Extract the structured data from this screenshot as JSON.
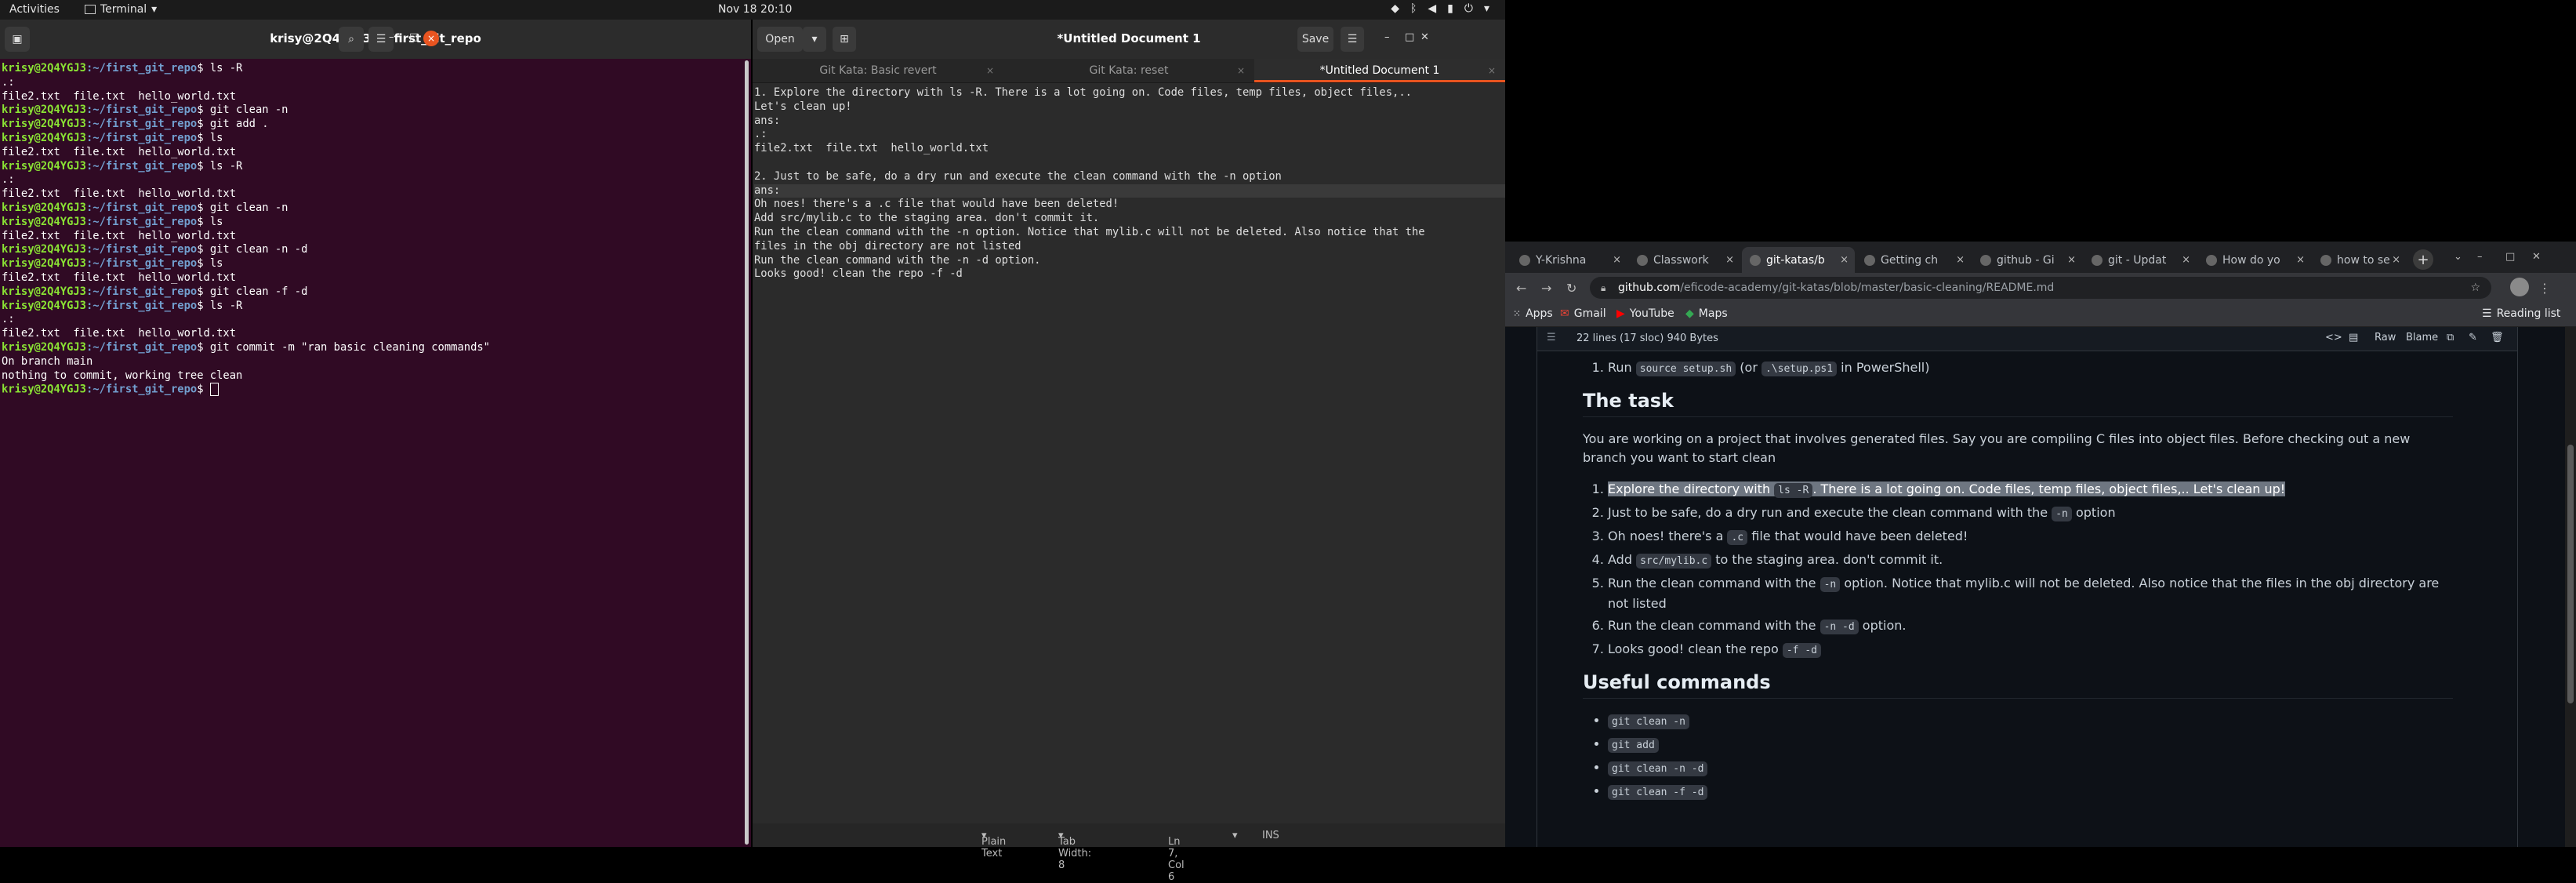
{
  "topbar": {
    "activities": "Activities",
    "app_name": "Terminal",
    "clock": "Nov 18  20:10"
  },
  "terminal": {
    "title": "krisy@2Q4YGJ3: ~/first_git_repo",
    "lines": [
      {
        "kind": "cmd",
        "user": "krisy@2Q4YGJ3",
        "path": ":~/first_git_repo",
        "cmd": "$ ls -R"
      },
      {
        "kind": "out",
        "text": ".:"
      },
      {
        "kind": "out",
        "text": "file2.txt  file.txt  hello_world.txt"
      },
      {
        "kind": "cmd",
        "user": "krisy@2Q4YGJ3",
        "path": ":~/first_git_repo",
        "cmd": "$ git clean -n"
      },
      {
        "kind": "cmd",
        "user": "krisy@2Q4YGJ3",
        "path": ":~/first_git_repo",
        "cmd": "$ git add ."
      },
      {
        "kind": "cmd",
        "user": "krisy@2Q4YGJ3",
        "path": ":~/first_git_repo",
        "cmd": "$ ls"
      },
      {
        "kind": "out",
        "text": "file2.txt  file.txt  hello_world.txt"
      },
      {
        "kind": "cmd",
        "user": "krisy@2Q4YGJ3",
        "path": ":~/first_git_repo",
        "cmd": "$ ls -R"
      },
      {
        "kind": "out",
        "text": ".:"
      },
      {
        "kind": "out",
        "text": "file2.txt  file.txt  hello_world.txt"
      },
      {
        "kind": "cmd",
        "user": "krisy@2Q4YGJ3",
        "path": ":~/first_git_repo",
        "cmd": "$ git clean -n"
      },
      {
        "kind": "cmd",
        "user": "krisy@2Q4YGJ3",
        "path": ":~/first_git_repo",
        "cmd": "$ ls"
      },
      {
        "kind": "out",
        "text": "file2.txt  file.txt  hello_world.txt"
      },
      {
        "kind": "cmd",
        "user": "krisy@2Q4YGJ3",
        "path": ":~/first_git_repo",
        "cmd": "$ git clean -n -d"
      },
      {
        "kind": "cmd",
        "user": "krisy@2Q4YGJ3",
        "path": ":~/first_git_repo",
        "cmd": "$ ls"
      },
      {
        "kind": "out",
        "text": "file2.txt  file.txt  hello_world.txt"
      },
      {
        "kind": "cmd",
        "user": "krisy@2Q4YGJ3",
        "path": ":~/first_git_repo",
        "cmd": "$ git clean -f -d"
      },
      {
        "kind": "cmd",
        "user": "krisy@2Q4YGJ3",
        "path": ":~/first_git_repo",
        "cmd": "$ ls -R"
      },
      {
        "kind": "out",
        "text": ".:"
      },
      {
        "kind": "out",
        "text": "file2.txt  file.txt  hello_world.txt"
      },
      {
        "kind": "cmd",
        "user": "krisy@2Q4YGJ3",
        "path": ":~/first_git_repo",
        "cmd": "$ git commit -m \"ran basic cleaning commands\""
      },
      {
        "kind": "out",
        "text": "On branch main"
      },
      {
        "kind": "out",
        "text": "nothing to commit, working tree clean"
      },
      {
        "kind": "prompt",
        "user": "krisy@2Q4YGJ3",
        "path": ":~/first_git_repo",
        "cmd": "$ "
      }
    ]
  },
  "gedit": {
    "title": "*Untitled Document 1",
    "open_label": "Open",
    "save_label": "Save",
    "tabs": [
      "Git Kata: Basic revert",
      "Git Kata: reset",
      "*Untitled Document 1"
    ],
    "lines": [
      "1. Explore the directory with ls -R. There is a lot going on. Code files, temp files, object files,..",
      "Let's clean up!",
      "ans:",
      ".:",
      "file2.txt  file.txt  hello_world.txt",
      "",
      "2. Just to be safe, do a dry run and execute the clean command with the -n option",
      "ans:",
      "Oh noes! there's a .c file that would have been deleted!",
      "Add src/mylib.c to the staging area. don't commit it.",
      "Run the clean command with the -n option. Notice that mylib.c will not be deleted. Also notice that the",
      "files in the obj directory are not listed",
      "Run the clean command with the -n -d option.",
      "Looks good! clean the repo -f -d"
    ],
    "status": {
      "language": "Plain Text",
      "tab_width": "Tab Width: 8",
      "position": "Ln 7, Col 6",
      "mode": "INS"
    }
  },
  "browser": {
    "tabs": [
      {
        "label": "Y-Krishna"
      },
      {
        "label": "Classwork"
      },
      {
        "label": "git-katas/b"
      },
      {
        "label": "Getting ch"
      },
      {
        "label": "github - Gi"
      },
      {
        "label": "git - Updat"
      },
      {
        "label": "How do yo"
      },
      {
        "label": "how to se"
      }
    ],
    "url_host": "github.com",
    "url_path": "/eficode-academy/git-katas/blob/master/basic-cleaning/README.md",
    "bookmarks": [
      "Apps",
      "Gmail",
      "YouTube",
      "Maps"
    ],
    "reading_list": "Reading list",
    "file_meta": "22 lines (17 sloc)    940 Bytes",
    "raw_label": "Raw",
    "blame_label": "Blame",
    "readme": {
      "setup_prefix": "Run",
      "setup_code1": "source setup.sh",
      "setup_mid": "(or",
      "setup_code2": ".\\setup.ps1",
      "setup_suffix": "in PowerShell)",
      "task_heading": "The task",
      "task_intro": "You are working on a project that involves generated files. Say you are compiling C files into object files. Before checking out a new branch you want to start clean",
      "step1_a": "Explore the directory with",
      "step1_code": "ls -R",
      "step1_b": ". There is a lot going on. Code files, temp files, object files,.. Let's clean up!",
      "step2_a": "Just to be safe, do a dry run and execute the clean command with the",
      "step2_code": "-n",
      "step2_b": "option",
      "step3_a": "Oh noes! there's a",
      "step3_code": ".c",
      "step3_b": "file that would have been deleted!",
      "step4_a": "Add",
      "step4_code": "src/mylib.c",
      "step4_b": "to the staging area. don't commit it.",
      "step5_a": "Run the clean command with the",
      "step5_code": "-n",
      "step5_b": "option. Notice that mylib.c will not be deleted. Also notice that the files in the obj directory are not listed",
      "step6_a": "Run the clean command with the",
      "step6_code": "-n -d",
      "step6_b": "option.",
      "step7_a": "Looks good! clean the repo",
      "step7_code": "-f -d",
      "useful_heading": "Useful commands",
      "commands": [
        "git clean -n",
        "git add",
        "git clean -n -d",
        "git clean -f -d"
      ]
    }
  }
}
